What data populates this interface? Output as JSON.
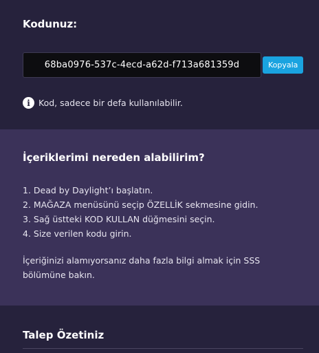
{
  "code_section": {
    "title": "Kodunuz:",
    "code_value": "68ba0976-537c-4ecd-a62d-f713a681359d",
    "copy_label": "Kopyala",
    "note_icon": "info-icon",
    "note_text": "Kod, sadece bir defa kullanılabilir."
  },
  "help_section": {
    "title": "İçeriklerimi nereden alabilirim?",
    "steps": [
      "1. Dead by Daylight’ı başlatın.",
      "2. MAĞAZA menüsünü seçip ÖZELLİK sekmesine gidin.",
      "3. Sağ üstteki KOD KULLAN düğmesini seçin.",
      "4. Size verilen kodu girin."
    ],
    "footer_text": "İçeriğinizi alamıyorsanız daha fazla bilgi almak için SSS bölümüne bakın."
  },
  "summary_section": {
    "title": "Talep Özetiniz"
  },
  "colors": {
    "background_dark": "#26223c",
    "background_panel": "#3b3259",
    "code_box": "#0d0d10",
    "accent": "#1aa3e0"
  }
}
